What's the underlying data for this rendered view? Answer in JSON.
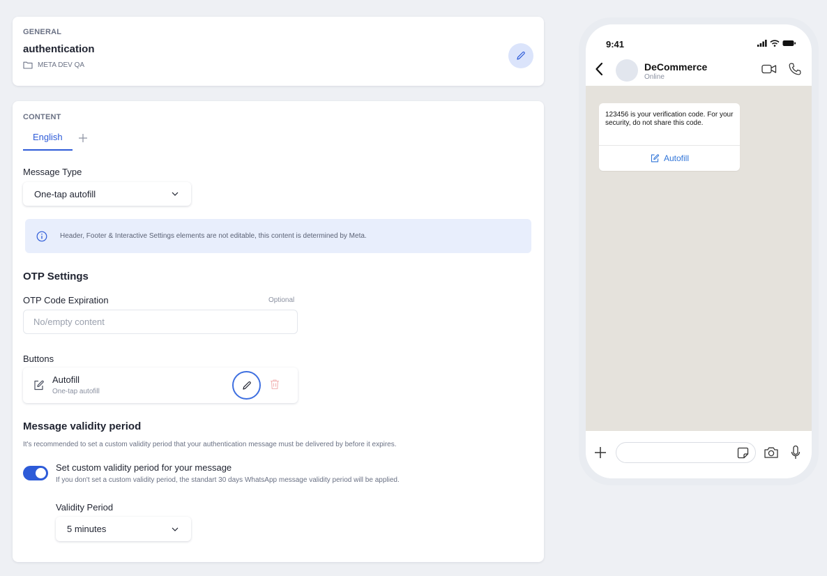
{
  "general": {
    "section_label": "GENERAL",
    "template_name": "authentication",
    "folder": "META DEV QA",
    "edit_icon": "pencil-icon"
  },
  "content": {
    "section_label": "CONTENT",
    "tabs": [
      {
        "label": "English",
        "active": true
      }
    ],
    "add_language_icon": "plus-icon",
    "message_type_label": "Message Type",
    "message_type_value": "One-tap autofill",
    "info_banner": "Header, Footer & Interactive Settings elements are not editable, this content is determined by Meta.",
    "otp_settings_title": "OTP Settings",
    "otp_expiration_label": "OTP Code Expiration",
    "otp_expiration_optional": "Optional",
    "otp_expiration_placeholder": "No/empty content",
    "buttons_label": "Buttons",
    "button_item": {
      "title": "Autofill",
      "subtitle": "One-tap autofill"
    },
    "validity_title": "Message validity period",
    "validity_description": "It's recommended to set a custom validity period that your authentication message must be delivered by before it expires.",
    "custom_validity_toggle": {
      "on": true,
      "label": "Set custom validity period for your message",
      "hint": "If you don't set a custom validity period, the standart 30 days WhatsApp message validity period will be applied."
    },
    "validity_period_label": "Validity Period",
    "validity_period_value": "5 minutes"
  },
  "preview": {
    "status_time": "9:41",
    "contact_name": "DeCommerce",
    "contact_status": "Online",
    "message_text": "123456 is your verification code. For your security, do not share this code.",
    "message_button": "Autofill"
  },
  "colors": {
    "accent": "#2d5bd8",
    "accent_light": "#dbe4fb",
    "info_bg": "#e8eefc",
    "page_bg": "#eef0f4",
    "chat_bg": "#e5e2dc",
    "danger_muted": "#f2b4b4"
  }
}
